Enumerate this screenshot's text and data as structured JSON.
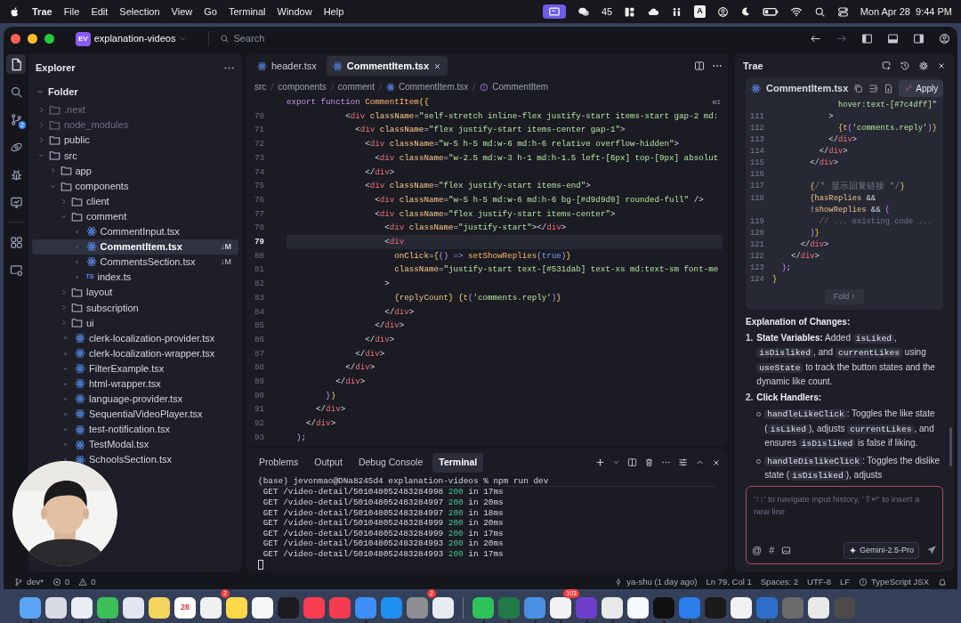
{
  "menu_bar": {
    "app": "Trae",
    "menus": [
      "File",
      "Edit",
      "Selection",
      "View",
      "Go",
      "Terminal",
      "Window",
      "Help"
    ],
    "wechat_count": "45",
    "input_source": "A",
    "datetime": "Mon Apr 28  9:44 PM"
  },
  "title_bar": {
    "workspace_badge": "EV",
    "workspace": "explanation-videos",
    "search_placeholder": "Search"
  },
  "activity_bar": [
    {
      "kind": "files",
      "selected": true
    },
    {
      "kind": "search",
      "selected": false
    },
    {
      "kind": "branch",
      "selected": false,
      "badge": "2"
    },
    {
      "kind": "orbit",
      "selected": false
    },
    {
      "kind": "bug",
      "selected": false
    },
    {
      "kind": "monitor",
      "selected": false
    },
    {
      "kind": "grid",
      "selected": false
    },
    {
      "kind": "screen",
      "selected": false
    }
  ],
  "explorer": {
    "title": "Explorer",
    "section": "Folder",
    "tree": [
      {
        "kind": "folder",
        "label": ".next",
        "expanded": false,
        "ignored": true
      },
      {
        "kind": "folder",
        "label": "node_modules",
        "expanded": false,
        "ignored": true
      },
      {
        "kind": "folder",
        "label": "public",
        "expanded": false,
        "ignored": false
      },
      {
        "kind": "folder",
        "label": "src",
        "expanded": true,
        "ignored": false,
        "children": [
          {
            "kind": "folder",
            "label": "app",
            "expanded": false,
            "ignored": false
          },
          {
            "kind": "folder",
            "label": "components",
            "expanded": true,
            "ignored": false,
            "children": [
              {
                "kind": "folder",
                "label": "client",
                "expanded": false,
                "ignored": false
              },
              {
                "kind": "folder",
                "label": "comment",
                "expanded": true,
                "ignored": false,
                "children": [
                  {
                    "kind": "react",
                    "label": "CommentInput.tsx",
                    "selected": false,
                    "ignored": false
                  },
                  {
                    "kind": "react",
                    "label": "CommentItem.tsx",
                    "selected": true,
                    "ignored": false,
                    "git_status": "↓M"
                  },
                  {
                    "kind": "react",
                    "label": "CommentsSection.tsx",
                    "selected": false,
                    "ignored": false,
                    "git_status": "↓M"
                  },
                  {
                    "kind": "ts",
                    "icon_text": "TS",
                    "label": "index.ts",
                    "selected": false,
                    "ignored": false
                  }
                ]
              },
              {
                "kind": "folder",
                "label": "layout",
                "expanded": false,
                "ignored": false
              },
              {
                "kind": "folder",
                "label": "subscription",
                "expanded": false,
                "ignored": false
              },
              {
                "kind": "folder",
                "label": "ui",
                "expanded": false,
                "ignored": false
              },
              {
                "kind": "react",
                "label": "clerk-localization-provider.tsx",
                "selected": false,
                "ignored": false
              },
              {
                "kind": "react",
                "label": "clerk-localization-wrapper.tsx",
                "selected": false,
                "ignored": false
              },
              {
                "kind": "react",
                "label": "FilterExample.tsx",
                "selected": false,
                "ignored": false
              },
              {
                "kind": "react",
                "label": "html-wrapper.tsx",
                "selected": false,
                "ignored": false
              },
              {
                "kind": "react",
                "label": "language-provider.tsx",
                "selected": false,
                "ignored": false
              },
              {
                "kind": "react",
                "label": "SequentialVideoPlayer.tsx",
                "selected": false,
                "ignored": false
              },
              {
                "kind": "react",
                "label": "test-notification.tsx",
                "selected": false,
                "ignored": false
              },
              {
                "kind": "react",
                "label": "TestModal.tsx",
                "selected": false,
                "ignored": false
              },
              {
                "kind": "react",
                "label": "SchoolsSection.tsx",
                "selected": false,
                "ignored": false
              }
            ]
          }
        ]
      }
    ]
  },
  "editor": {
    "tabs": [
      {
        "label": "header.tsx",
        "selected": false
      },
      {
        "label": "CommentItem.tsx",
        "selected": true
      }
    ],
    "breadcrumbs": [
      {
        "kind": "folder",
        "label": "src"
      },
      {
        "kind": "folder",
        "label": "components"
      },
      {
        "kind": "folder",
        "label": "comment"
      },
      {
        "kind": "react",
        "label": "CommentItem.tsx"
      },
      {
        "kind": "symbol",
        "label": "CommentItem"
      }
    ],
    "sticky_line": [
      {
        "kind": "kw",
        "text": "export function "
      },
      {
        "kind": "fn",
        "text": "CommentItem"
      },
      {
        "kind": "br",
        "text": "({"
      }
    ],
    "minimap_label": "m1",
    "lines": [
      {
        "number": "70",
        "current": false,
        "tokens": [
          {
            "kind": "p",
            "text": "            <"
          },
          {
            "kind": "tag",
            "text": "div "
          },
          {
            "kind": "attr",
            "text": "className"
          },
          {
            "kind": "p",
            "text": "="
          },
          {
            "kind": "str",
            "text": "\"self-stretch inline-flex justify-start items-start gap-2 md:"
          }
        ]
      },
      {
        "number": "71",
        "current": false,
        "tokens": [
          {
            "kind": "p",
            "text": "              <"
          },
          {
            "kind": "tag",
            "text": "div "
          },
          {
            "kind": "attr",
            "text": "className"
          },
          {
            "kind": "p",
            "text": "="
          },
          {
            "kind": "str",
            "text": "\"flex justify-start items-center gap-1\""
          },
          {
            "kind": "p",
            "text": ">"
          }
        ]
      },
      {
        "number": "72",
        "current": false,
        "tokens": [
          {
            "kind": "p",
            "text": "                <"
          },
          {
            "kind": "tag",
            "text": "div "
          },
          {
            "kind": "attr",
            "text": "className"
          },
          {
            "kind": "p",
            "text": "="
          },
          {
            "kind": "str",
            "text": "\"w-5 h-5 md:w-6 md:h-6 relative overflow-hidden\""
          },
          {
            "kind": "p",
            "text": ">"
          }
        ]
      },
      {
        "number": "73",
        "current": false,
        "tokens": [
          {
            "kind": "p",
            "text": "                  <"
          },
          {
            "kind": "tag",
            "text": "div "
          },
          {
            "kind": "attr",
            "text": "className"
          },
          {
            "kind": "p",
            "text": "="
          },
          {
            "kind": "str",
            "text": "\"w-2.5 md:w-3 h-1 md:h-1.5 left-[6px] top-[9px] absolut"
          }
        ]
      },
      {
        "number": "74",
        "current": false,
        "tokens": [
          {
            "kind": "p",
            "text": "                </"
          },
          {
            "kind": "tag",
            "text": "div"
          },
          {
            "kind": "p",
            "text": ">"
          }
        ]
      },
      {
        "number": "75",
        "current": false,
        "tokens": [
          {
            "kind": "p",
            "text": "                <"
          },
          {
            "kind": "tag",
            "text": "div "
          },
          {
            "kind": "attr",
            "text": "className"
          },
          {
            "kind": "p",
            "text": "="
          },
          {
            "kind": "str",
            "text": "\"flex justify-start items-end\""
          },
          {
            "kind": "p",
            "text": ">"
          }
        ]
      },
      {
        "number": "76",
        "current": false,
        "tokens": [
          {
            "kind": "p",
            "text": "                  <"
          },
          {
            "kind": "tag",
            "text": "div "
          },
          {
            "kind": "attr",
            "text": "className"
          },
          {
            "kind": "p",
            "text": "="
          },
          {
            "kind": "str",
            "text": "\"w-5 h-5 md:w-6 md:h-6 bg-[#d9d9d9] rounded-full\""
          },
          {
            "kind": "p",
            "text": " />"
          }
        ]
      },
      {
        "number": "77",
        "current": false,
        "tokens": [
          {
            "kind": "p",
            "text": "                  <"
          },
          {
            "kind": "tag",
            "text": "div "
          },
          {
            "kind": "attr",
            "text": "className"
          },
          {
            "kind": "p",
            "text": "="
          },
          {
            "kind": "str",
            "text": "\"flex justify-start items-center\""
          },
          {
            "kind": "p",
            "text": ">"
          }
        ]
      },
      {
        "number": "78",
        "current": false,
        "tokens": [
          {
            "kind": "p",
            "text": "                    <"
          },
          {
            "kind": "tag",
            "text": "div "
          },
          {
            "kind": "attr",
            "text": "className"
          },
          {
            "kind": "p",
            "text": "="
          },
          {
            "kind": "str",
            "text": "\"justify-start\""
          },
          {
            "kind": "p",
            "text": "></"
          },
          {
            "kind": "tag",
            "text": "div"
          },
          {
            "kind": "p",
            "text": ">"
          }
        ]
      },
      {
        "number": "79",
        "current": true,
        "tokens": [
          {
            "kind": "p",
            "text": "                    <"
          },
          {
            "kind": "tag",
            "text": "div"
          }
        ]
      },
      {
        "number": "80",
        "current": false,
        "tokens": [
          {
            "kind": "attr",
            "text": "                      onClick"
          },
          {
            "kind": "p",
            "text": "="
          },
          {
            "kind": "br",
            "text": "{"
          },
          {
            "kind": "pa",
            "text": "() "
          },
          {
            "kind": "op",
            "text": "=> "
          },
          {
            "kind": "fn",
            "text": "setShowReplies"
          },
          {
            "kind": "pa",
            "text": "("
          },
          {
            "kind": "bool",
            "text": "true"
          },
          {
            "kind": "pa",
            "text": ")"
          },
          {
            "kind": "br",
            "text": "}"
          }
        ]
      },
      {
        "number": "81",
        "current": false,
        "tokens": [
          {
            "kind": "attr",
            "text": "                      className"
          },
          {
            "kind": "p",
            "text": "="
          },
          {
            "kind": "str",
            "text": "\"justify-start text-[#531dab] text-xs md:text-sm font-me"
          }
        ]
      },
      {
        "number": "82",
        "current": false,
        "tokens": [
          {
            "kind": "p",
            "text": "                    >"
          }
        ]
      },
      {
        "number": "83",
        "current": false,
        "tokens": [
          {
            "kind": "br",
            "text": "                      {"
          },
          {
            "kind": "var",
            "text": "replyCount"
          },
          {
            "kind": "br",
            "text": "} {"
          },
          {
            "kind": "fn",
            "text": "t"
          },
          {
            "kind": "pa",
            "text": "("
          },
          {
            "kind": "str",
            "text": "'comments.reply'"
          },
          {
            "kind": "pa",
            "text": ")"
          },
          {
            "kind": "br",
            "text": "}"
          }
        ]
      },
      {
        "number": "84",
        "current": false,
        "tokens": [
          {
            "kind": "p",
            "text": "                    </"
          },
          {
            "kind": "tag",
            "text": "div"
          },
          {
            "kind": "p",
            "text": ">"
          }
        ]
      },
      {
        "number": "85",
        "current": false,
        "tokens": [
          {
            "kind": "p",
            "text": "                  </"
          },
          {
            "kind": "tag",
            "text": "div"
          },
          {
            "kind": "p",
            "text": ">"
          }
        ]
      },
      {
        "number": "86",
        "current": false,
        "tokens": [
          {
            "kind": "p",
            "text": "                </"
          },
          {
            "kind": "tag",
            "text": "div"
          },
          {
            "kind": "p",
            "text": ">"
          }
        ]
      },
      {
        "number": "87",
        "current": false,
        "tokens": [
          {
            "kind": "p",
            "text": "              </"
          },
          {
            "kind": "tag",
            "text": "div"
          },
          {
            "kind": "p",
            "text": ">"
          }
        ]
      },
      {
        "number": "88",
        "current": false,
        "tokens": [
          {
            "kind": "p",
            "text": "            </"
          },
          {
            "kind": "tag",
            "text": "div"
          },
          {
            "kind": "p",
            "text": ">"
          }
        ]
      },
      {
        "number": "89",
        "current": false,
        "tokens": [
          {
            "kind": "p",
            "text": "          </"
          },
          {
            "kind": "tag",
            "text": "div"
          },
          {
            "kind": "p",
            "text": ">"
          }
        ]
      },
      {
        "number": "90",
        "current": false,
        "tokens": [
          {
            "kind": "pa",
            "text": "        }"
          },
          {
            "kind": "br",
            "text": ")"
          }
        ]
      },
      {
        "number": "91",
        "current": false,
        "tokens": [
          {
            "kind": "p",
            "text": "      </"
          },
          {
            "kind": "tag",
            "text": "div"
          },
          {
            "kind": "p",
            "text": ">"
          }
        ]
      },
      {
        "number": "92",
        "current": false,
        "tokens": [
          {
            "kind": "p",
            "text": "    </"
          },
          {
            "kind": "tag",
            "text": "div"
          },
          {
            "kind": "p",
            "text": ">"
          }
        ]
      },
      {
        "number": "93",
        "current": false,
        "tokens": [
          {
            "kind": "pa",
            "text": "  )"
          },
          {
            "kind": "p",
            "text": ";"
          }
        ]
      }
    ]
  },
  "panel": {
    "tabs": [
      {
        "label": "Problems",
        "selected": false
      },
      {
        "label": "Output",
        "selected": false
      },
      {
        "label": "Debug Console",
        "selected": false
      },
      {
        "label": "Terminal",
        "selected": true
      }
    ],
    "prompt": "(base) jevonmao@DNa8245d4 explanation-videos % npm run dev",
    "requests": [
      {
        "path": "GET /video-detail/501048052483284998",
        "status": "200",
        "duration": "in 17ms"
      },
      {
        "path": "GET /video-detail/501048052483284997",
        "status": "200",
        "duration": "in 20ms"
      },
      {
        "path": "GET /video-detail/501048052483284997",
        "status": "200",
        "duration": "in 18ms"
      },
      {
        "path": "GET /video-detail/501048052483284999",
        "status": "200",
        "duration": "in 20ms"
      },
      {
        "path": "GET /video-detail/501048052483284999",
        "status": "200",
        "duration": "in 17ms"
      },
      {
        "path": "GET /video-detail/501048052483284993",
        "status": "200",
        "duration": "in 20ms"
      },
      {
        "path": "GET /video-detail/501048052483284993",
        "status": "200",
        "duration": "in 17ms"
      }
    ]
  },
  "assistant": {
    "title": "Trae",
    "code_block": {
      "file": "CommentItem.tsx",
      "apply": "Apply",
      "fold": "Fold ↑",
      "lines": [
        {
          "tokens": [
            {
              "kind": "str",
              "text": "              hover:text-[#7c4dff]\""
            }
          ]
        },
        {
          "number": "111",
          "tokens": [
            {
              "kind": "p",
              "text": "            >"
            }
          ]
        },
        {
          "number": "112",
          "tokens": [
            {
              "kind": "br",
              "text": "              {"
            },
            {
              "kind": "fn",
              "text": "t"
            },
            {
              "kind": "pa",
              "text": "("
            },
            {
              "kind": "str",
              "text": "'comments.reply'"
            },
            {
              "kind": "pa",
              "text": ")"
            },
            {
              "kind": "br",
              "text": "}"
            }
          ]
        },
        {
          "number": "113",
          "tokens": [
            {
              "kind": "p",
              "text": "            </"
            },
            {
              "kind": "tag",
              "text": "div"
            },
            {
              "kind": "p",
              "text": ">"
            }
          ]
        },
        {
          "number": "114",
          "tokens": [
            {
              "kind": "p",
              "text": "          </"
            },
            {
              "kind": "tag",
              "text": "div"
            },
            {
              "kind": "p",
              "text": ">"
            }
          ]
        },
        {
          "number": "115",
          "tokens": [
            {
              "kind": "p",
              "text": "        </"
            },
            {
              "kind": "tag",
              "text": "div"
            },
            {
              "kind": "p",
              "text": ">"
            }
          ]
        },
        {
          "number": "116"
        },
        {
          "number": "117",
          "tokens": [
            {
              "kind": "br",
              "text": "        {"
            },
            {
              "kind": "cmt",
              "text": "/* 显示回复链接 */"
            },
            {
              "kind": "br",
              "text": "}"
            }
          ]
        },
        {
          "number": "118",
          "tokens": [
            {
              "kind": "br",
              "text": "        {"
            },
            {
              "kind": "var",
              "text": "hasReplies"
            },
            {
              "kind": "p",
              "text": " &&"
            }
          ]
        },
        {
          "tokens": [
            {
              "kind": "p",
              "text": "        !"
            },
            {
              "kind": "var",
              "text": "showReplies"
            },
            {
              "kind": "p",
              "text": " && "
            },
            {
              "kind": "pa",
              "text": "("
            }
          ]
        },
        {
          "number": "119",
          "tokens": [
            {
              "kind": "cmt",
              "text": "          // ... existing code ..."
            }
          ]
        },
        {
          "number": "120",
          "tokens": [
            {
              "kind": "pa",
              "text": "        )"
            },
            {
              "kind": "br",
              "text": "}"
            }
          ]
        },
        {
          "number": "121",
          "tokens": [
            {
              "kind": "p",
              "text": "      </"
            },
            {
              "kind": "tag",
              "text": "div"
            },
            {
              "kind": "p",
              "text": ">"
            }
          ]
        },
        {
          "number": "122",
          "tokens": [
            {
              "kind": "p",
              "text": "    </"
            },
            {
              "kind": "tag",
              "text": "div"
            },
            {
              "kind": "p",
              "text": ">"
            }
          ]
        },
        {
          "number": "123",
          "tokens": [
            {
              "kind": "pa",
              "text": "  )"
            },
            {
              "kind": "p",
              "text": ";"
            }
          ]
        },
        {
          "number": "124",
          "tokens": [
            {
              "kind": "br",
              "text": "}"
            }
          ]
        }
      ]
    },
    "explanation": {
      "heading": "Explanation of Changes:",
      "items": [
        {
          "marker": "1.",
          "segments": [
            {
              "kind": "b",
              "text": "State Variables:"
            },
            {
              "kind": "t",
              "text": " Added "
            },
            {
              "kind": "c",
              "text": "isLiked"
            },
            {
              "kind": "t",
              "text": ", "
            },
            {
              "kind": "c",
              "text": "isDisliked"
            },
            {
              "kind": "t",
              "text": ", and "
            },
            {
              "kind": "c",
              "text": "currentLikes"
            },
            {
              "kind": "t",
              "text": " using "
            },
            {
              "kind": "c",
              "text": "useState"
            },
            {
              "kind": "t",
              "text": " to track the button states and the dynamic like count."
            }
          ]
        },
        {
          "marker": "2.",
          "segments": [
            {
              "kind": "b",
              "text": "Click Handlers:"
            }
          ],
          "children": [
            {
              "segments": [
                {
                  "kind": "c",
                  "text": "handleLikeClick"
                },
                {
                  "kind": "t",
                  "text": ": Toggles the like state ("
                },
                {
                  "kind": "c",
                  "text": "isLiked"
                },
                {
                  "kind": "t",
                  "text": "), adjusts "
                },
                {
                  "kind": "c",
                  "text": "currentLikes"
                },
                {
                  "kind": "t",
                  "text": ", and ensures "
                },
                {
                  "kind": "c",
                  "text": "isDisliked"
                },
                {
                  "kind": "t",
                  "text": " is false if liking."
                }
              ]
            },
            {
              "segments": [
                {
                  "kind": "c",
                  "text": "handleDislikeClick"
                },
                {
                  "kind": "t",
                  "text": ": Toggles the dislike state ("
                },
                {
                  "kind": "c",
                  "text": "isDisliked"
                },
                {
                  "kind": "t",
                  "text": "), adjusts"
                }
              ]
            }
          ]
        }
      ]
    },
    "input": {
      "placeholder": "'↑↓' to navigate input history, '⇧↵' to insert a new line",
      "mention": "@",
      "context": "#",
      "model": "Gemini-2.5-Pro"
    }
  },
  "status_bar": {
    "branch": "dev*",
    "errors": "0",
    "warnings": "0",
    "blame": "ya-shu (1 day ago)",
    "position": "Ln 79, Col 1",
    "indent": "Spaces: 2",
    "encoding": "UTF-8",
    "eol": "LF",
    "language": "TypeScript JSX"
  },
  "dock": {
    "apps": [
      {
        "color": "#5aa5f5",
        "running": true
      },
      {
        "color": "#d8dbe3",
        "running": false
      },
      {
        "color": "#e9eef5",
        "running": true
      },
      {
        "color": "#3cc05a",
        "running": true
      },
      {
        "color": "#e2e6ee",
        "running": false
      },
      {
        "color": "#f4d35e",
        "running": false
      },
      {
        "color": "#ffffff",
        "running": false,
        "label": "28"
      },
      {
        "color": "#f0f0f0",
        "running": false,
        "badge": "2"
      },
      {
        "color": "#ffd94a",
        "running": false
      },
      {
        "color": "#f6f6f6",
        "running": false
      },
      {
        "color": "#1c1c1e",
        "running": false
      },
      {
        "color": "#fa3c52",
        "running": false
      },
      {
        "color": "#f53b4f",
        "running": false
      },
      {
        "color": "#3b8ff6",
        "running": true
      },
      {
        "color": "#1f8ef1",
        "running": false
      },
      {
        "color": "#8e8e93",
        "running": false,
        "badge": "2"
      },
      {
        "color": "#e8ecf2",
        "running": false
      }
    ],
    "others": [
      {
        "color": "#2fc15a",
        "running": true
      },
      {
        "color": "#1f7a45",
        "running": true
      },
      {
        "color": "#4a90e2",
        "running": true
      },
      {
        "color": "#f2f2f2",
        "running": true,
        "badge": "103"
      },
      {
        "color": "#6e40c9",
        "running": true
      },
      {
        "color": "#e8e8e8",
        "running": true
      },
      {
        "color": "#f4f8ff",
        "running": true
      },
      {
        "color": "#111111",
        "running": true
      },
      {
        "color": "#2b7de9",
        "running": true
      },
      {
        "color": "#1b1b1b",
        "running": false
      },
      {
        "color": "#f2f2f2",
        "running": false
      },
      {
        "color": "#2d6ecb",
        "running": true
      },
      {
        "color": "#6a6a6a",
        "running": false
      },
      {
        "color": "#e9e9e9",
        "running": false
      },
      {
        "color": "#4b4b4b",
        "running": false
      }
    ]
  }
}
